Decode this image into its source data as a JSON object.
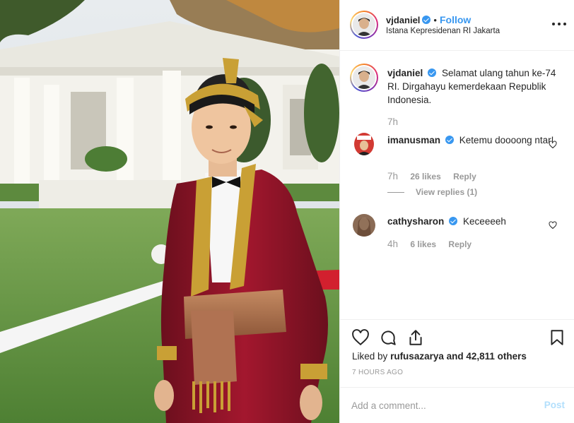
{
  "post": {
    "author": "vjdaniel",
    "follow_label": "Follow",
    "location": "Istana Kepresidenan RI Jakarta",
    "dot": "•"
  },
  "caption": {
    "username": "vjdaniel",
    "text": "Selamat ulang tahun ke-74 RI. Dirgahayu kemerdekaan Republik Indonesia.",
    "time": "7h"
  },
  "comments": [
    {
      "username": "imanusman",
      "text": "Ketemu doooong ntar!",
      "time": "7h",
      "likes": "26 likes",
      "reply": "Reply",
      "view_replies": "View replies (1)"
    },
    {
      "username": "cathysharon",
      "text": "Keceeeeh",
      "time": "4h",
      "likes": "6 likes",
      "reply": "Reply"
    }
  ],
  "engagement": {
    "liked_by_prefix": "Liked by",
    "liked_by_user": "rufusazarya",
    "liked_by_suffix": "and 42,811 others",
    "time_ago": "7 HOURS AGO"
  },
  "composer": {
    "placeholder": "Add a comment...",
    "post_label": "Post"
  },
  "icons": {
    "more": "more-icon",
    "like": "heart-icon",
    "comment": "comment-icon",
    "share": "share-icon",
    "save": "bookmark-icon"
  },
  "colors": {
    "accent": "#3897f0",
    "text": "#262626",
    "muted": "#999999",
    "post_disabled": "#b2dffc"
  }
}
